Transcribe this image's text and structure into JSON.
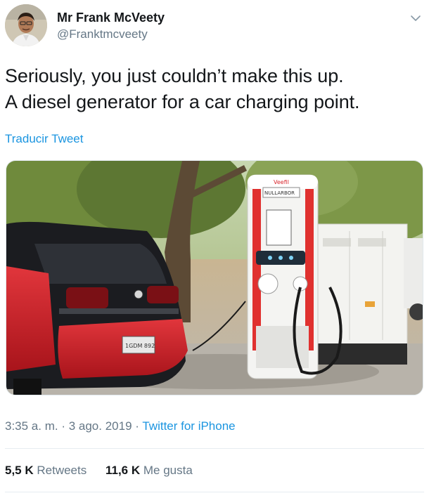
{
  "user": {
    "display_name": "Mr Frank McVeety",
    "handle": "@Franktmcveety"
  },
  "tweet": {
    "line1": "Seriously, you just couldn’t make this up.",
    "line2": "A diesel generator for a car charging point.",
    "translate_label": "Traducir Tweet"
  },
  "meta": {
    "time": "3:35 a. m.",
    "sep1": " · ",
    "date": "3 ago. 2019",
    "sep2": " · ",
    "source": "Twitter for iPhone"
  },
  "stats": {
    "retweets_count": "5,5 K",
    "retweets_label": "Retweets",
    "likes_count": "11,6 K",
    "likes_label": "Me gusta"
  },
  "charger": {
    "brand": "Veefil",
    "model": "NULLARBOR"
  },
  "car": {
    "plate": "1GDM 892"
  },
  "icons": {
    "menu": "chevron-down-icon"
  },
  "colors": {
    "link": "#1b95e0",
    "secondary_text": "#657786",
    "primary_text": "#14171a"
  }
}
